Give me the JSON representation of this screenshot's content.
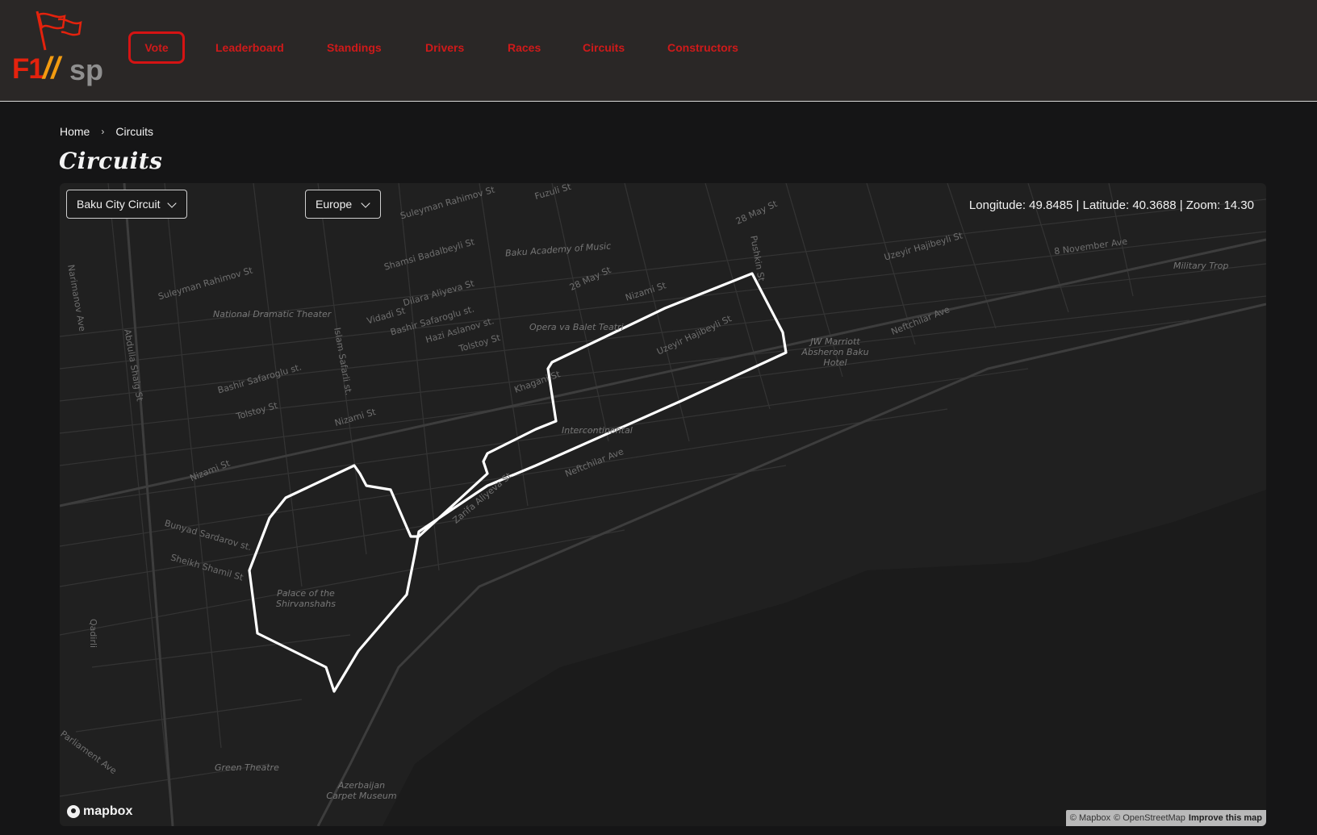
{
  "brand": {
    "f1": "F1",
    "slash": "//",
    "sp": "sp"
  },
  "nav": {
    "items": [
      {
        "label": "Vote",
        "active": true
      },
      {
        "label": "Leaderboard"
      },
      {
        "label": "Standings"
      },
      {
        "label": "Drivers"
      },
      {
        "label": "Races"
      },
      {
        "label": "Circuits"
      },
      {
        "label": "Constructors"
      }
    ]
  },
  "breadcrumb": {
    "home": "Home",
    "current": "Circuits"
  },
  "page": {
    "title": "Circuits"
  },
  "map": {
    "circuit_select": "Baku City Circuit",
    "region_select": "Europe",
    "coords_text": "Longitude: 49.8485 | Latitude: 40.3688 | Zoom: 14.30",
    "mapbox_label": "mapbox",
    "attribution": {
      "mapbox": "© Mapbox",
      "osm": "© OpenStreetMap",
      "improve": "Improve this map"
    },
    "labels": [
      "Suleyman Rahimov St",
      "Fuzuli St",
      "28 May St",
      "Shamsi Badalbeyli St",
      "Baku Academy of Music",
      "Uzeyir Hajibeyli St",
      "8 November Ave",
      "Military Trop",
      "Suleyman Rahimov St",
      "National Dramatic Theater",
      "Dilara Aliyeva St",
      "Bashir Safaroglu st.",
      "Vidadi St",
      "Hazi Aslanov st.",
      "Tolstoy St",
      "Opera va Balet Teatri",
      "Nizami St",
      "28 May St",
      "Uzeyir Hajibeyli St",
      "JW Marriott Absheron Baku Hotel",
      "Neftchilar Ave",
      "Narimanov Ave",
      "Abdulla Shaig St",
      "Islam Safarli st.",
      "Bashir Safaroglu st.",
      "Tolstoy St",
      "Nizami St",
      "Khagani St",
      "Intercontinental",
      "Neftchilar Ave",
      "Zarifa Aliyeva St",
      "Nizami St",
      "Bunyad Sardarov st.",
      "Sheikh Shamil St",
      "Palace of the Shirvanshahs",
      "Qadirli",
      "Parliament Ave",
      "Green Theatre",
      "Azerbaijan Carpet Museum",
      "Pushkin St"
    ]
  }
}
